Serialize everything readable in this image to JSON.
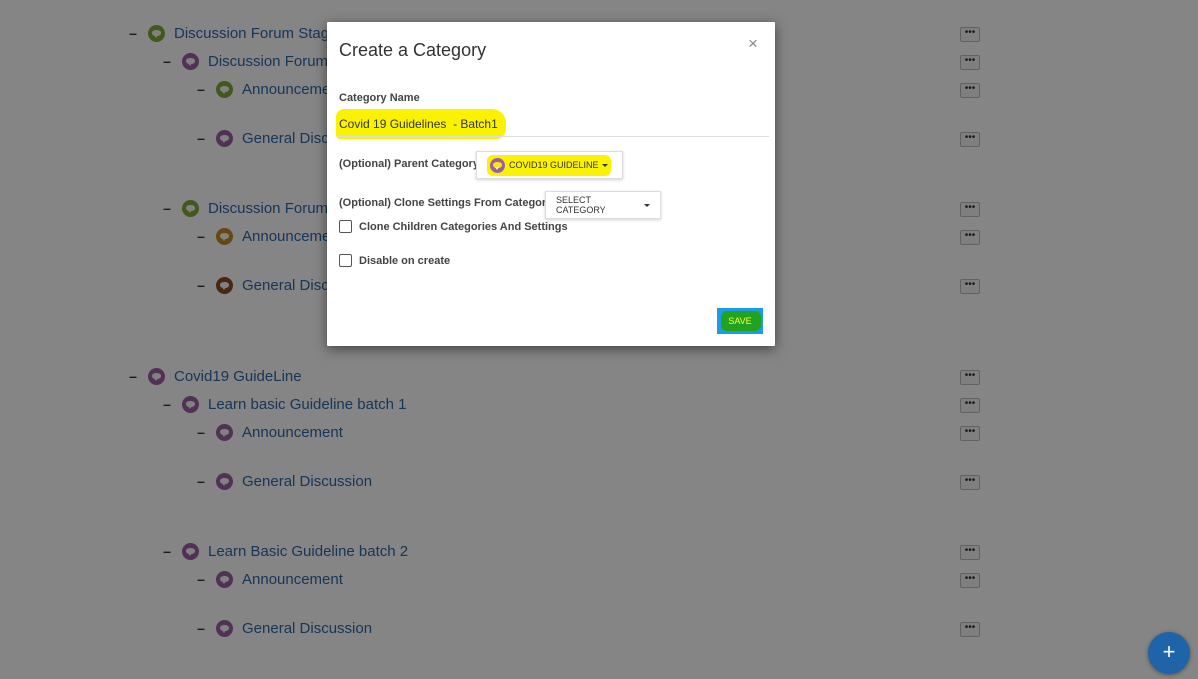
{
  "tree": [
    {
      "label": "Discussion Forum Stagi",
      "level": 0,
      "color": "#7eaa3a"
    },
    {
      "label": "Discussion Forum",
      "level": 1,
      "color": "#9c5fa3"
    },
    {
      "label": "Announceme",
      "level": 2,
      "color": "#7eaa3a"
    },
    {
      "label": "General Discu",
      "level": 2,
      "color": "#9c5fa3"
    },
    {
      "label": "Discussion Forum",
      "level": 1,
      "color": "#7eaa3a"
    },
    {
      "label": "Announceme",
      "level": 2,
      "color": "#c58a27"
    },
    {
      "label": "General Discu",
      "level": 2,
      "color": "#8b4e1f"
    },
    {
      "label": "Covid19 GuideLine",
      "level": 0,
      "color": "#9c5fa3"
    },
    {
      "label": "Learn basic Guideline batch 1",
      "level": 1,
      "color": "#9c5fa3"
    },
    {
      "label": "Announcement",
      "level": 2,
      "color": "#9c5fa3"
    },
    {
      "label": "General Discussion",
      "level": 2,
      "color": "#9c5fa3"
    },
    {
      "label": "Learn Basic Guideline batch 2",
      "level": 1,
      "color": "#9c5fa3"
    },
    {
      "label": "Announcement",
      "level": 2,
      "color": "#9c5fa3"
    },
    {
      "label": "General Discussion",
      "level": 2,
      "color": "#9c5fa3"
    }
  ],
  "tree_collapse_symbol": "–",
  "tree_menu_symbol": "•••",
  "fab": {
    "symbol": "+"
  },
  "modal": {
    "title": "Create a Category",
    "close_symbol": "×",
    "category_name_label": "Category Name",
    "category_name_value": "Covid 19 Guidelines  - Batch1",
    "parent_category_label": "(Optional) Parent Category",
    "parent_category_value": "COVID19 GUIDELINE",
    "clone_settings_label": "(Optional) Clone Settings From Category",
    "clone_settings_value": "SELECT CATEGORY",
    "clone_children_label": "Clone Children Categories And Settings",
    "disable_on_create_label": "Disable on create",
    "save_label": "SAVE"
  },
  "colors": {
    "highlight": "#fbf200",
    "save_highlight": "#22a31f",
    "save_button": "#1e9be5",
    "link": "#2b6aa8",
    "fab": "#1f63a8"
  }
}
